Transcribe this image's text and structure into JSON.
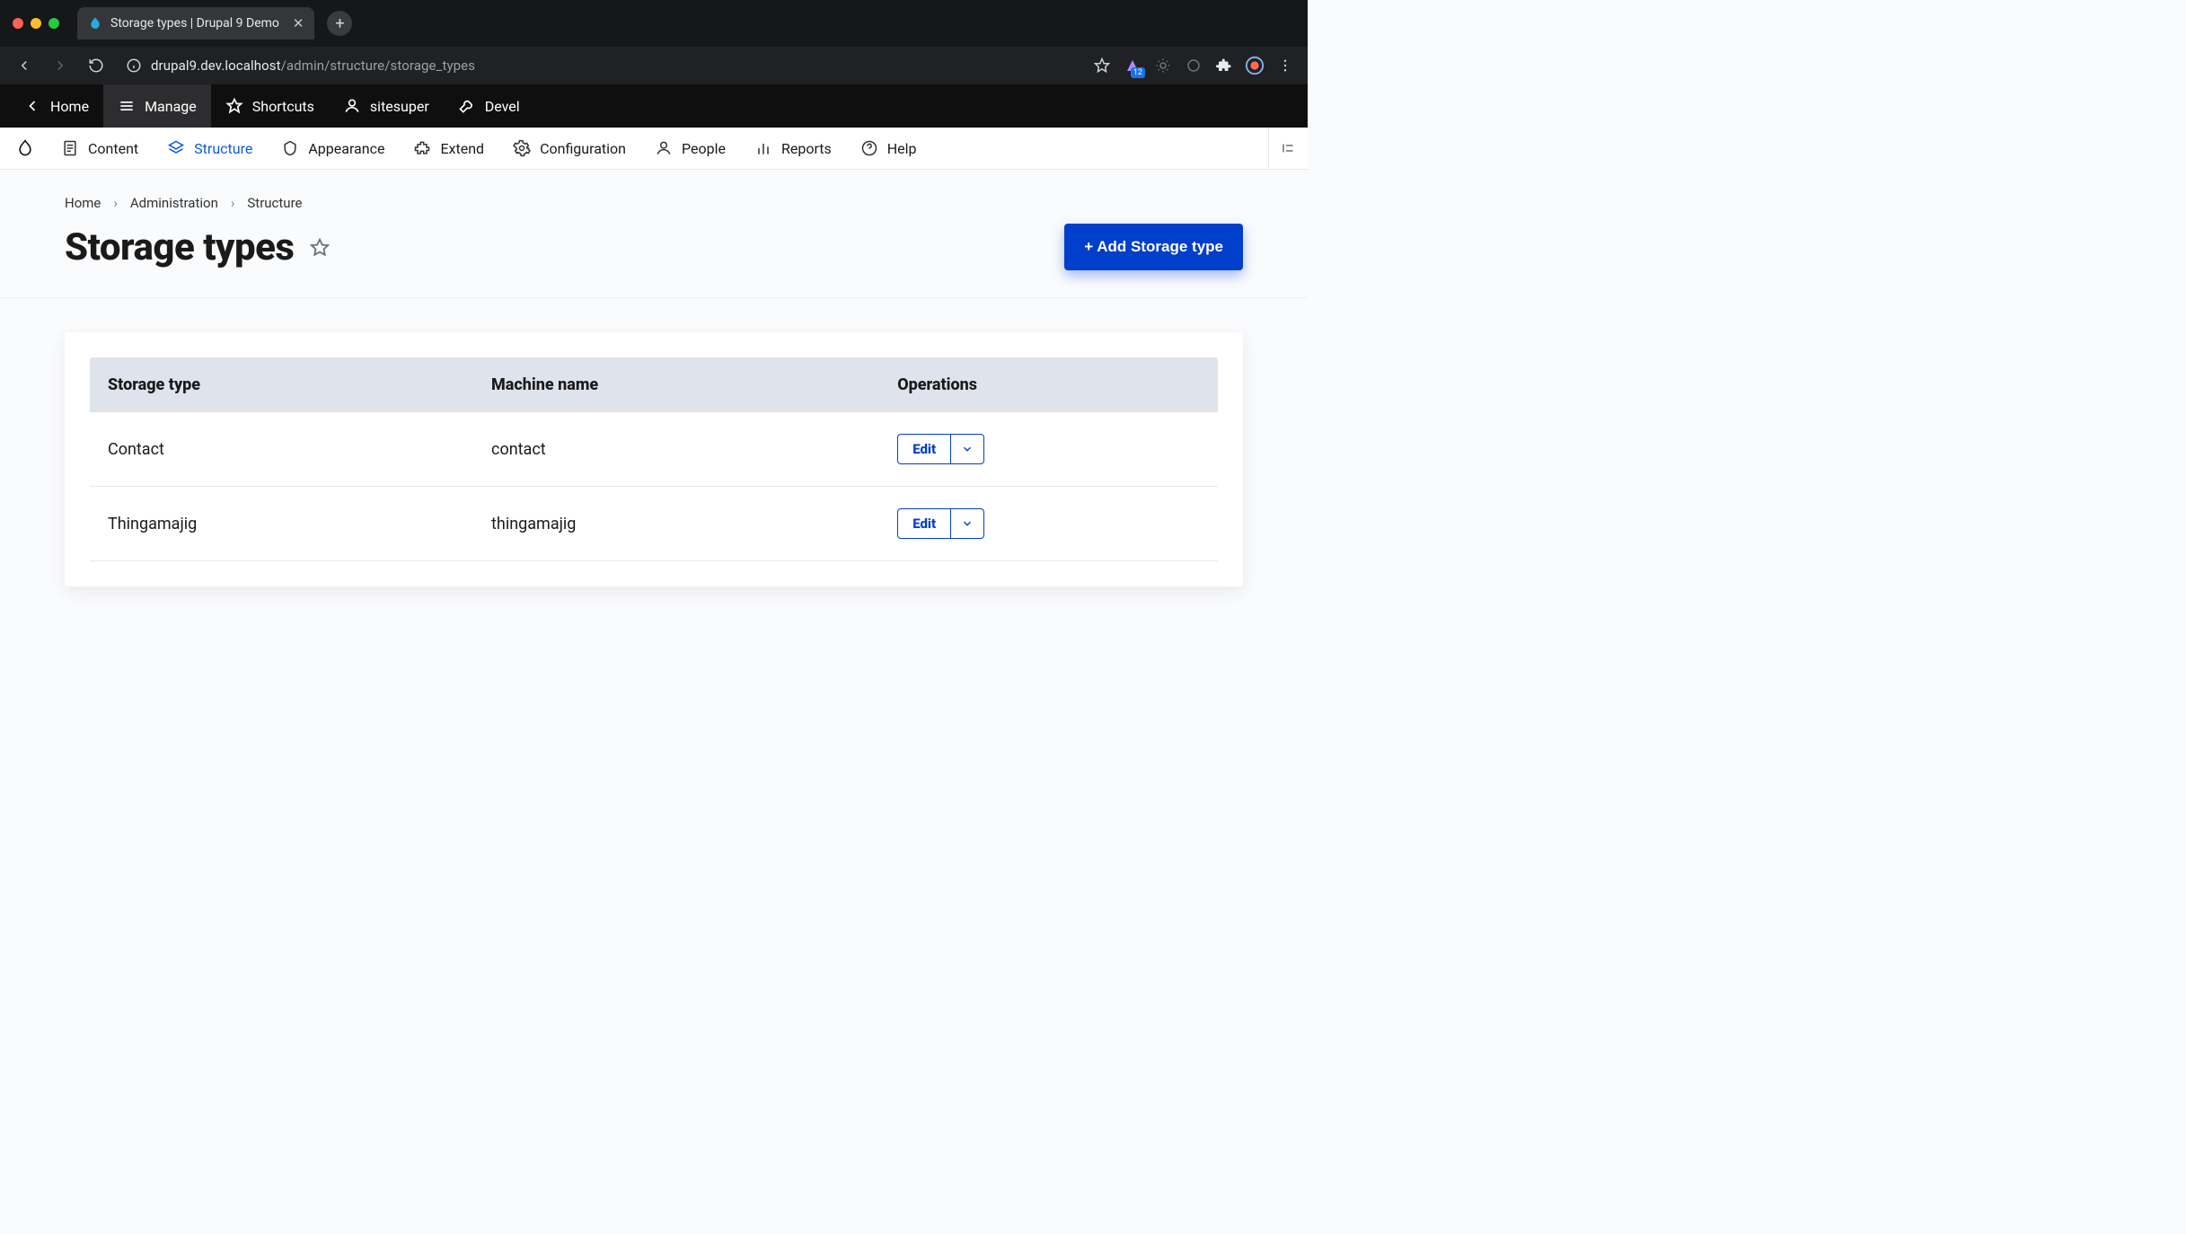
{
  "browser": {
    "tab_title": "Storage types | Drupal 9 Demo",
    "url_host": "drupal9.dev.localhost",
    "url_path": "/admin/structure/storage_types",
    "new_tab_glyph": "+",
    "ext_badge": "12"
  },
  "toolbar": {
    "home": "Home",
    "manage": "Manage",
    "shortcuts": "Shortcuts",
    "user": "sitesuper",
    "devel": "Devel"
  },
  "subnav": {
    "content": "Content",
    "structure": "Structure",
    "appearance": "Appearance",
    "extend": "Extend",
    "configuration": "Configuration",
    "people": "People",
    "reports": "Reports",
    "help": "Help"
  },
  "breadcrumbs": {
    "home": "Home",
    "admin": "Administration",
    "structure": "Structure"
  },
  "page": {
    "title": "Storage types",
    "add_button": "+ Add Storage type",
    "columns": {
      "name": "Storage type",
      "machine": "Machine name",
      "ops": "Operations"
    },
    "ops_label": "Edit",
    "rows": [
      {
        "name": "Contact",
        "machine": "contact"
      },
      {
        "name": "Thingamajig",
        "machine": "thingamajig"
      }
    ]
  }
}
